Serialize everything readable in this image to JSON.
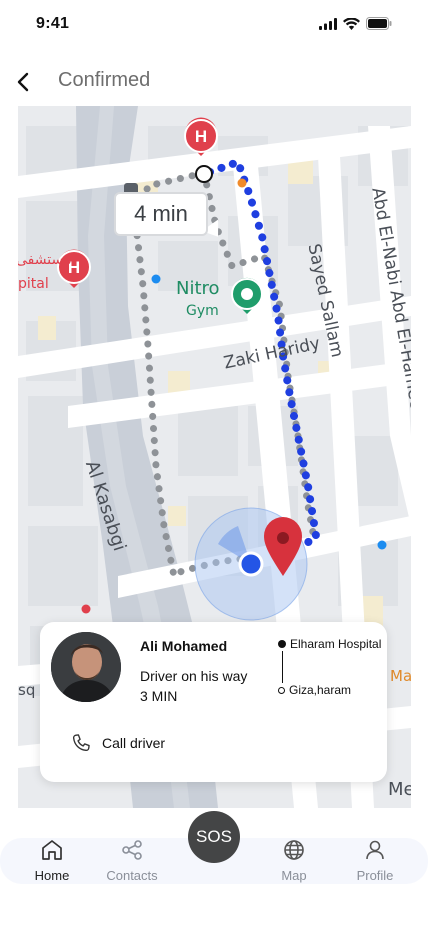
{
  "status_bar": {
    "time": "9:41"
  },
  "header": {
    "title": "Confirmed"
  },
  "map": {
    "eta": "4 min",
    "labels": {
      "place_name": "Nitro",
      "place_type": "Gym",
      "street_1": "Zaki Haridy",
      "street_2": "Sayed Sallam",
      "street_3": "Abd El-Nabi Abd El-Hameed",
      "street_4": "Al Kasabgi",
      "partial_1": "مستشفى",
      "partial_2": "pital",
      "partial_3": "sq",
      "partial_4": "Ma",
      "partial_5": "Me"
    },
    "colors": {
      "route_blue": "#1f3fe0",
      "route_gray": "#8e9297",
      "hospital_red": "#e0404c",
      "pin_red": "#d7323d",
      "place_green": "#1f9d6b"
    }
  },
  "driver_card": {
    "name": "Ali Mohamed",
    "status": "Driver on his way",
    "eta": "3 MIN",
    "pickup": "Elharam Hospital",
    "destination": "Giza,haram",
    "call_label": "Call driver"
  },
  "nav": {
    "items": [
      {
        "label": "Home",
        "icon": "home-icon",
        "active": true
      },
      {
        "label": "Contacts",
        "icon": "share-icon",
        "active": false
      },
      {
        "label": "Map",
        "icon": "globe-icon",
        "active": false
      },
      {
        "label": "Profile",
        "icon": "person-icon",
        "active": false
      }
    ],
    "sos_label": "SOS"
  }
}
